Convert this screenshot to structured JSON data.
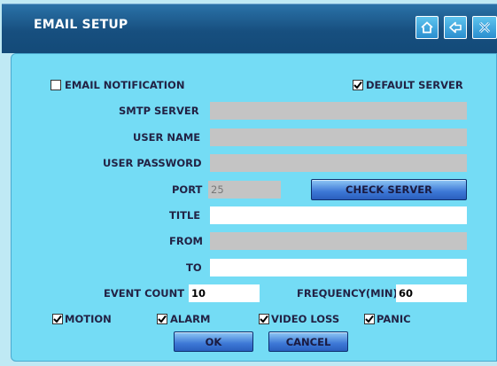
{
  "window": {
    "title": "EMAIL SETUP",
    "buttons": {
      "home_icon": "home-icon",
      "back_icon": "arrow-left-icon",
      "close_icon": "close-icon"
    }
  },
  "options": {
    "email_notification": {
      "label": "EMAIL NOTIFICATION",
      "checked": false
    },
    "default_server": {
      "label": "DEFAULT SERVER",
      "checked": true
    }
  },
  "form": {
    "smtp_server": {
      "label": "SMTP SERVER",
      "value": ""
    },
    "user_name": {
      "label": "USER NAME",
      "value": ""
    },
    "user_password": {
      "label": "USER PASSWORD",
      "value": ""
    },
    "port": {
      "label": "PORT",
      "value": "25"
    },
    "check_server_label": "CHECK SERVER",
    "title": {
      "label": "TITLE",
      "value": ""
    },
    "from": {
      "label": "FROM",
      "value": ""
    },
    "to": {
      "label": "TO",
      "value": ""
    },
    "event_count": {
      "label": "EVENT COUNT",
      "value": "10"
    },
    "frequency": {
      "label": "FREQUENCY(MIN)",
      "value": "60"
    }
  },
  "triggers": {
    "motion": {
      "label": "MOTION",
      "checked": true
    },
    "alarm": {
      "label": "ALARM",
      "checked": true
    },
    "video_loss": {
      "label": "VIDEO LOSS",
      "checked": true
    },
    "panic": {
      "label": "PANIC",
      "checked": true
    }
  },
  "footer": {
    "ok_label": "OK",
    "cancel_label": "CANCEL"
  },
  "colors": {
    "title_bar": "#1a5585",
    "panel": "#74dcf5",
    "button": "#3d78d6",
    "disabled_field": "#c4c4c4"
  }
}
